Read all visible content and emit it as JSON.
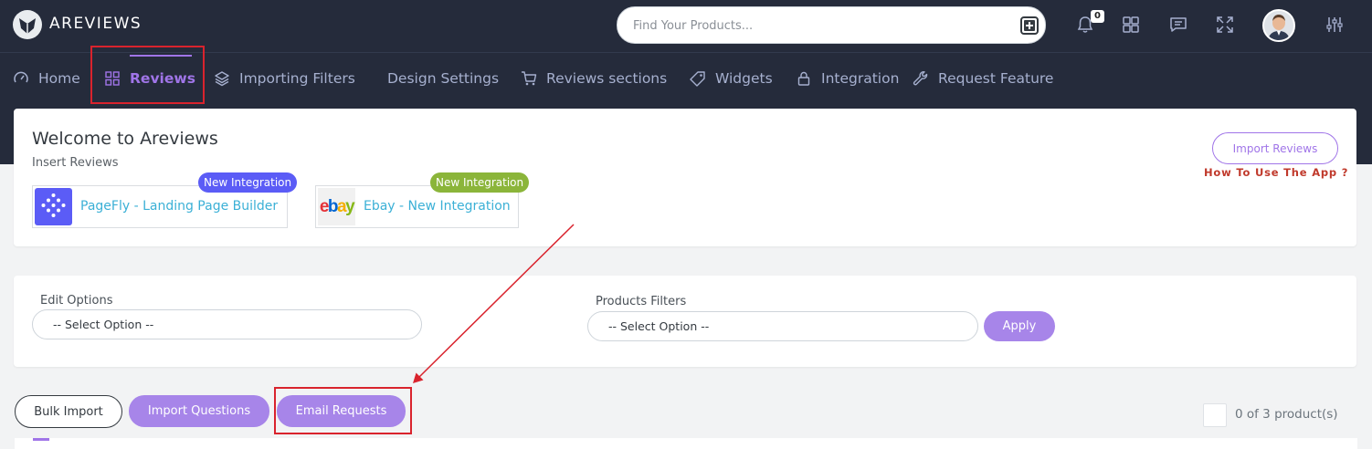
{
  "app": {
    "brand": "AREVIEWS"
  },
  "search": {
    "placeholder": "Find Your Products..."
  },
  "topbar": {
    "icons": [
      "add-product-icon",
      "bell-icon",
      "grid-icon",
      "chat-icon",
      "fullscreen-icon",
      "avatar",
      "settings-sliders-icon"
    ],
    "notification_count": "0"
  },
  "nav": {
    "items": [
      {
        "label": "Home",
        "icon": "gauge-icon"
      },
      {
        "label": "Reviews",
        "icon": "grid-icon",
        "active": true
      },
      {
        "label": "Importing Filters",
        "icon": "layers-icon"
      },
      {
        "label": "Design Settings",
        "icon": ""
      },
      {
        "label": "Reviews sections",
        "icon": "cart-icon"
      },
      {
        "label": "Widgets",
        "icon": "tag-icon"
      },
      {
        "label": "Integration",
        "icon": "lock-icon"
      },
      {
        "label": "Request Feature",
        "icon": "wrench-icon"
      }
    ]
  },
  "welcome": {
    "title": "Welcome to Areviews",
    "subtitle": "Insert Reviews",
    "import_button": "Import Reviews",
    "howto_link": "How To Use The App ?",
    "integrations": [
      {
        "name": "PageFly - Landing Page Builder",
        "badge": "New Integration",
        "badge_color": "#5b5cf6"
      },
      {
        "name": "Ebay - New Integration",
        "badge": "New Integration",
        "badge_color": "#8bb53a"
      }
    ],
    "ebay_logo_text": "ebay"
  },
  "filters": {
    "edit_options_label": "Edit Options",
    "edit_options_value": "-- Select Option --",
    "products_filters_label": "Products Filters",
    "products_filters_value": "-- Select Option --",
    "apply_button": "Apply"
  },
  "actions": {
    "bulk_import": "Bulk Import",
    "import_questions": "Import Questions",
    "email_requests": "Email Requests"
  },
  "products": {
    "count_text": "0 of 3 product(s)"
  },
  "colors": {
    "dark": "#252b3b",
    "accent": "#a075e8",
    "highlight": "#d9232d",
    "link": "#3bb0d6"
  }
}
